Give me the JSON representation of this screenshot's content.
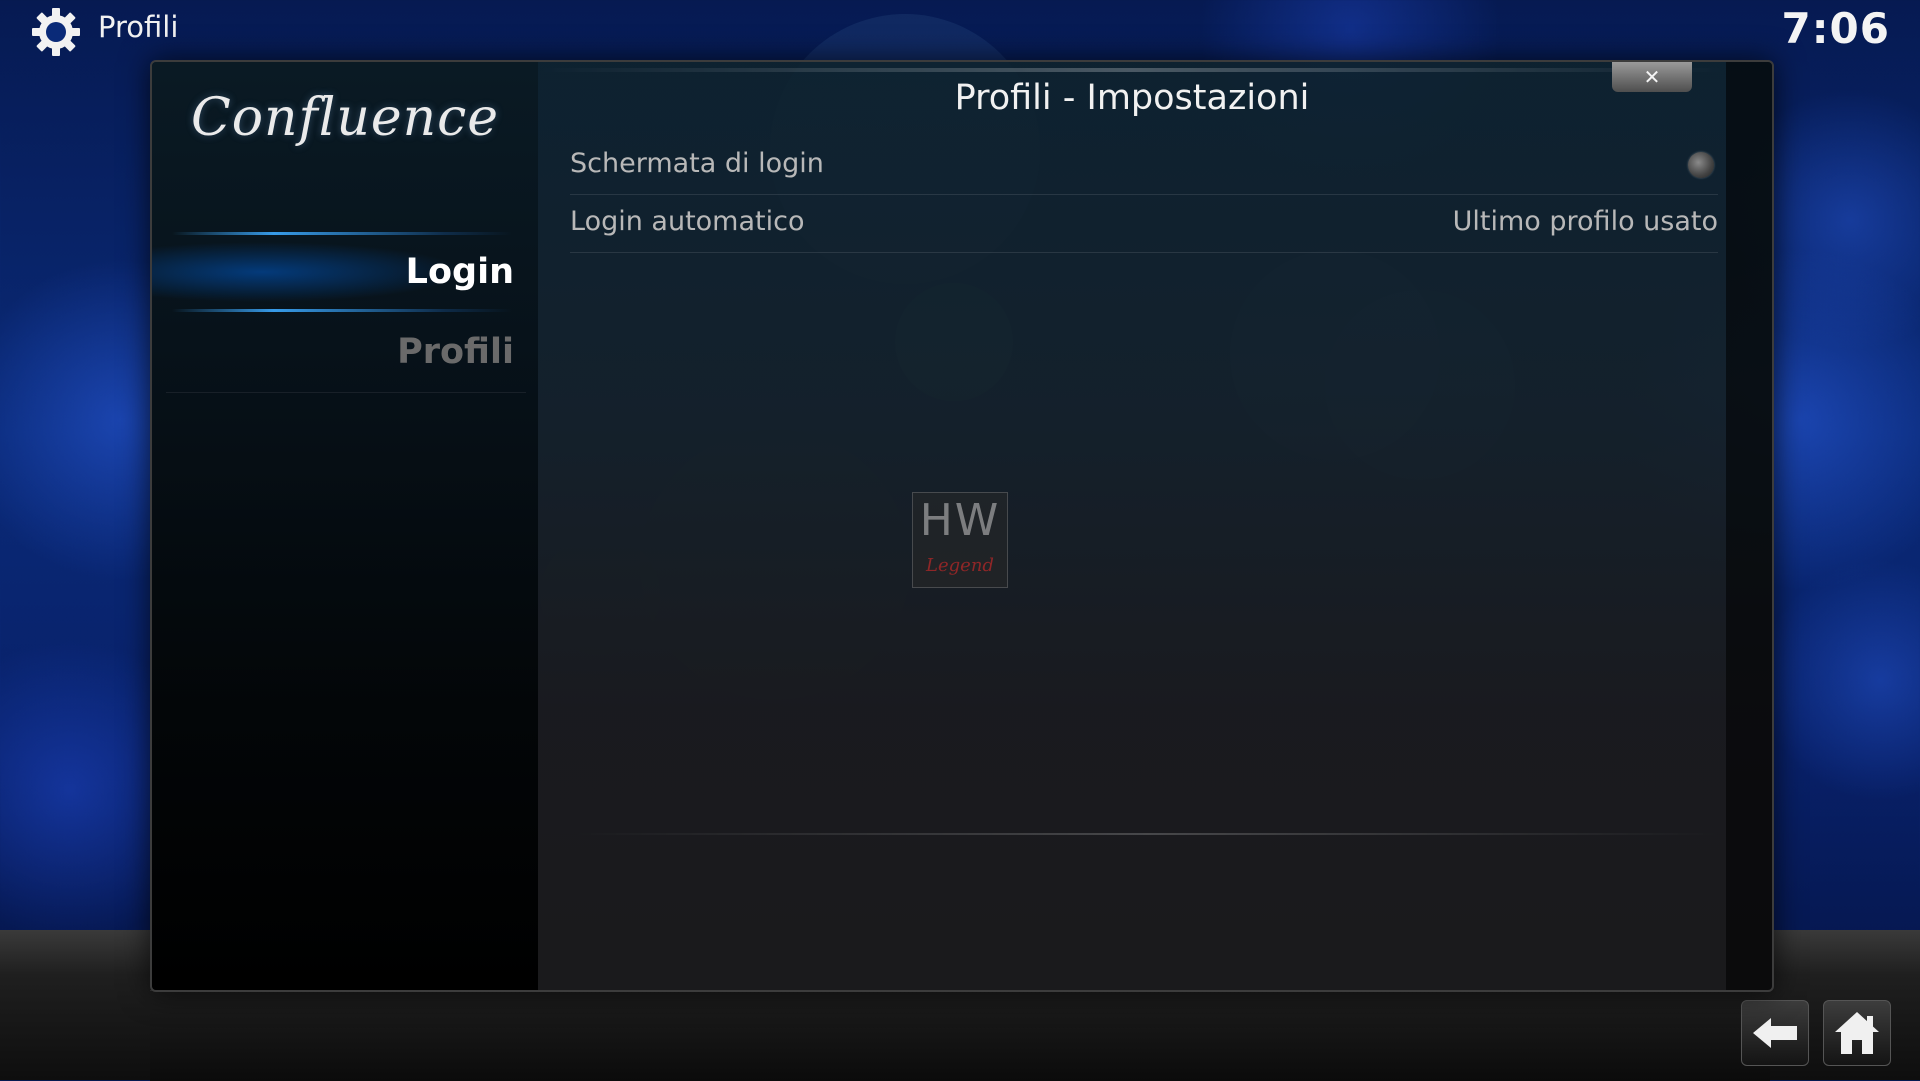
{
  "topbar": {
    "title": "Profili",
    "clock": "7:06"
  },
  "dialog": {
    "logo_text": "Confluence",
    "title": "Profili - Impostazioni",
    "close_label": "✕"
  },
  "sidebar": {
    "items": [
      {
        "label": "Login",
        "active": true
      },
      {
        "label": "Profili",
        "active": false
      }
    ]
  },
  "settings": [
    {
      "label": "Schermata di login",
      "type": "radio",
      "enabled": false
    },
    {
      "label": "Login automatico",
      "type": "value",
      "value": "Ultimo profilo usato"
    }
  ],
  "watermark": {
    "top": "HW",
    "bottom": "Legend"
  },
  "icons": {
    "topbar": "gear-icon",
    "close": "close-icon",
    "back": "back-arrow-icon",
    "home": "home-icon"
  },
  "colors": {
    "accent": "#2a8cff",
    "text": "#b8b8b8"
  }
}
